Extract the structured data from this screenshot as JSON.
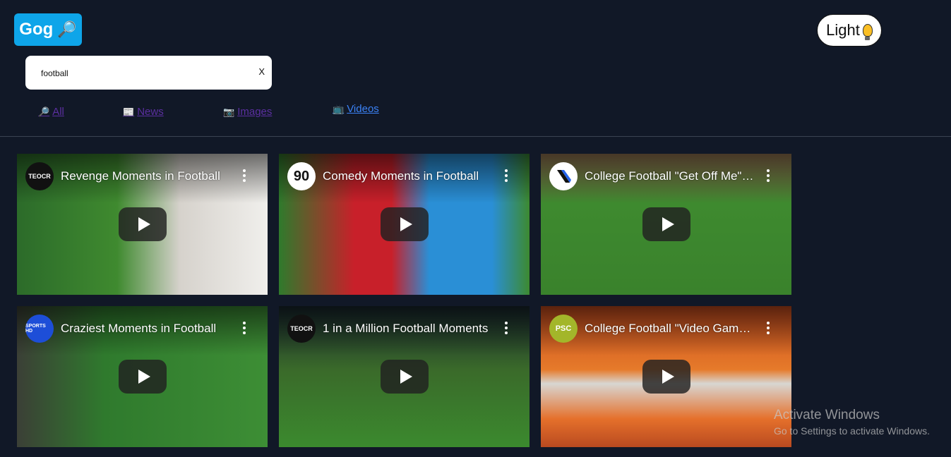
{
  "header": {
    "logo_text": "Gog",
    "logo_icon": "magnifier-icon",
    "theme_toggle_label": "Light",
    "theme_toggle_icon": "lightbulb-icon"
  },
  "search": {
    "value": "football",
    "clear_label": "X"
  },
  "tabs": [
    {
      "label": "All",
      "icon": "magnifier-icon",
      "glyph": "🔎",
      "active": false
    },
    {
      "label": "News",
      "icon": "newspaper-icon",
      "glyph": "📰",
      "active": false
    },
    {
      "label": "Images",
      "icon": "camera-icon",
      "glyph": "📷",
      "active": false
    },
    {
      "label": "Videos",
      "icon": "television-icon",
      "glyph": "📺",
      "active": true
    }
  ],
  "videos": [
    {
      "title": "Revenge Moments in Football",
      "channel": "TEOCR"
    },
    {
      "title": "Comedy Moments in Football",
      "channel": "90"
    },
    {
      "title": "College Football \"Get Off Me\" Moments",
      "channel": ""
    },
    {
      "title": "Craziest Moments in Football",
      "channel": "SPORTS HD"
    },
    {
      "title": "1 in a Million Football Moments",
      "channel": "TEOCR"
    },
    {
      "title": "College Football \"Video Game\" Moments",
      "channel": "PSC"
    }
  ],
  "colors": {
    "background": "#111827",
    "logo_bg": "#0ea5e9",
    "tab_visited": "#5b2fa0",
    "tab_active": "#3b82f6"
  },
  "watermark": {
    "title": "Activate Windows",
    "subtitle": "Go to Settings to activate Windows."
  }
}
